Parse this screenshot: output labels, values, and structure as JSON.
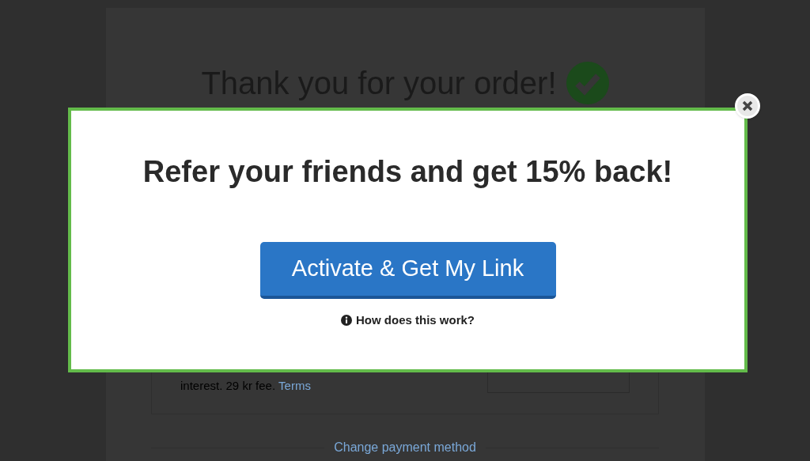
{
  "page": {
    "title": "Thank you for your order!",
    "payment_note": "interest. 29 kr fee.",
    "terms_link": "Terms",
    "change_payment_link": "Change payment method"
  },
  "modal": {
    "heading": "Refer your friends and get 15% back!",
    "button": "Activate & Get My Link",
    "help_link": "How does this work?"
  }
}
